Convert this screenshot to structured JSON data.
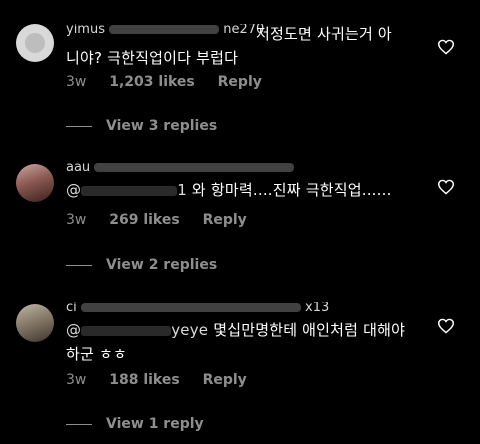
{
  "comments": [
    {
      "username_visible": "yimus",
      "username_tail": "ne270",
      "text_line1": "저정도면 사귀는거 아",
      "text_line2": "니야? 극한직업이다 부럽다",
      "time": "3w",
      "likes": "1,203 likes",
      "reply": "Reply",
      "view_replies": "View 3 replies",
      "heart_icon": "heart-outline-icon"
    },
    {
      "username_visible": "aau",
      "mention_prefix": "@",
      "mention_tail": "1",
      "text": "와 항마력....진짜 극한직업......",
      "time": "3w",
      "likes": "269 likes",
      "reply": "Reply",
      "view_replies": "View 2 replies",
      "heart_icon": "heart-outline-icon"
    },
    {
      "username_visible": "ci",
      "username_tail": "x13",
      "mention_prefix": "@",
      "mention_tail": "yeye",
      "text_line1": "몇십만명한테 애인처럼 대해야",
      "text_line2": "하군 ㅎㅎ",
      "time": "3w",
      "likes": "188 likes",
      "reply": "Reply",
      "view_replies": "View 1 reply",
      "heart_icon": "heart-outline-icon"
    }
  ]
}
